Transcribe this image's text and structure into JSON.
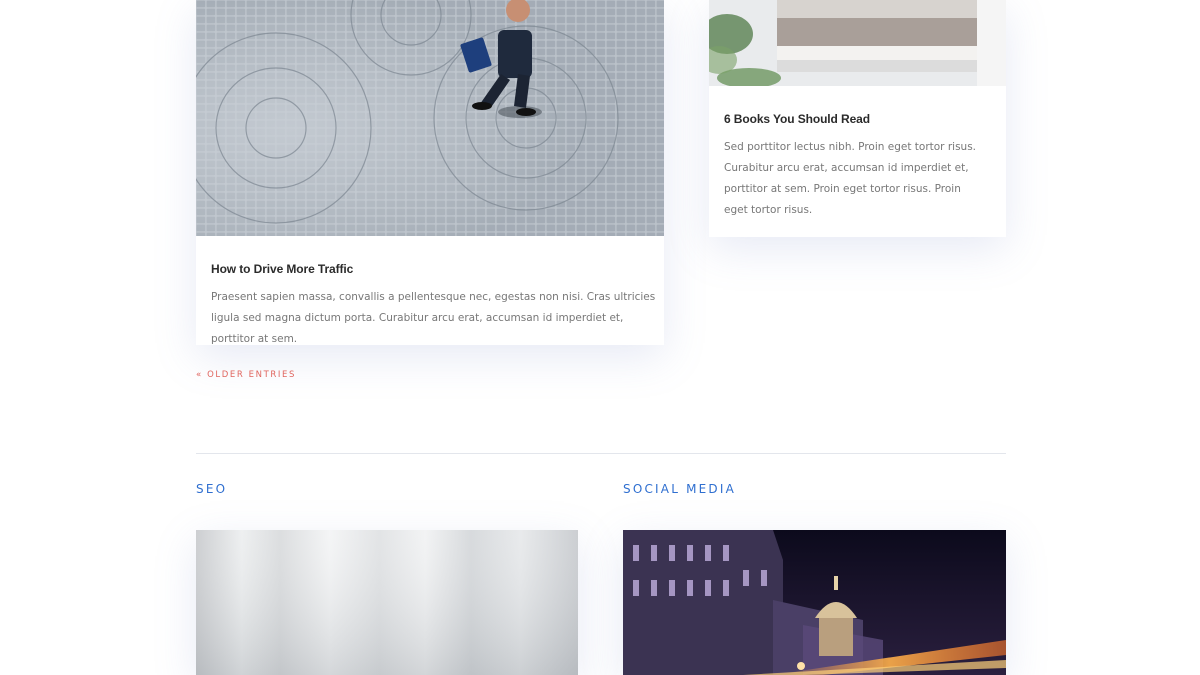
{
  "posts": [
    {
      "title": "How to Drive More Traffic",
      "excerpt": "Praesent sapien massa, convallis a pellentesque nec, egestas non nisi. Cras ultricies ligula sed magna dictum porta. Curabitur arcu erat, accumsan id imperdiet et, porttitor at sem."
    },
    {
      "title": "6 Books You Should Read",
      "excerpt": "Sed porttitor lectus nibh. Proin eget tortor risus. Curabitur arcu erat, accumsan id imperdiet et, porttitor at sem. Proin eget tortor risus. Proin eget tortor risus."
    }
  ],
  "pagination": {
    "older_label": "« OLDER ENTRIES"
  },
  "sections": [
    {
      "heading": "SEO"
    },
    {
      "heading": "SOCIAL MEDIA"
    }
  ],
  "colors": {
    "accent_link": "#e0655e",
    "section_heading": "#2f6fd0",
    "title": "#2b2b2b",
    "body_text": "#777777"
  }
}
